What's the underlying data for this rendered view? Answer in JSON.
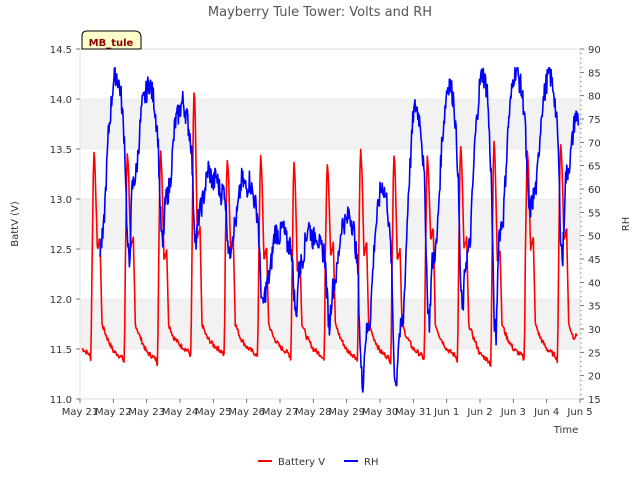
{
  "chart_data": {
    "type": "line",
    "title": "Mayberry Tule Tower: Volts and RH",
    "station_label": "MB_tule",
    "xlabel": "Time",
    "ylabel_left": "BattV (V)",
    "ylabel_right": "RH",
    "xlim": [
      "2016-05-21",
      "2016-06-05"
    ],
    "ylim_left": [
      11.0,
      14.5
    ],
    "ylim_right": [
      15,
      90
    ],
    "x_ticks": [
      "May 21",
      "May 22",
      "May 23",
      "May 24",
      "May 25",
      "May 26",
      "May 27",
      "May 28",
      "May 29",
      "May 30",
      "May 31",
      "Jun 1",
      "Jun 2",
      "Jun 3",
      "Jun 4",
      "Jun 5"
    ],
    "y_ticks_left": [
      "11.0",
      "11.5",
      "12.0",
      "12.5",
      "13.0",
      "13.5",
      "14.0",
      "14.5"
    ],
    "y_ticks_right": [
      "15",
      "20",
      "25",
      "30",
      "35",
      "40",
      "45",
      "50",
      "55",
      "60",
      "65",
      "70",
      "75",
      "80",
      "85",
      "90"
    ],
    "grid": "horizontal bands",
    "legend_position": "bottom-center",
    "series": [
      {
        "name": "Battery V",
        "axis": "left",
        "color": "#ff0000",
        "daily": [
          {
            "min": 11.4,
            "rise": 12.3,
            "peak": 13.5,
            "mid": 12.5
          },
          {
            "min": 11.36,
            "rise": 12.3,
            "peak": 13.5,
            "mid": 12.5
          },
          {
            "min": 11.35,
            "rise": 12.4,
            "peak": 13.5,
            "mid": 12.4
          },
          {
            "min": 11.42,
            "rise": 12.45,
            "peak": 14.1,
            "mid": 12.6
          },
          {
            "min": 11.42,
            "rise": 12.5,
            "peak": 13.43,
            "mid": 12.5
          },
          {
            "min": 11.4,
            "rise": 12.3,
            "peak": 13.45,
            "mid": 12.4
          },
          {
            "min": 11.4,
            "rise": 12.2,
            "peak": 13.4,
            "mid": 12.3
          },
          {
            "min": 11.38,
            "rise": 12.4,
            "peak": 13.4,
            "mid": 12.45
          },
          {
            "min": 11.37,
            "rise": 12.4,
            "peak": 13.52,
            "mid": 12.45
          },
          {
            "min": 11.36,
            "rise": 12.3,
            "peak": 13.48,
            "mid": 12.4
          },
          {
            "min": 11.38,
            "rise": 12.3,
            "peak": 13.45,
            "mid": 12.6
          },
          {
            "min": 11.38,
            "rise": 12.4,
            "peak": 13.55,
            "mid": 12.5
          },
          {
            "min": 11.33,
            "rise": 12.35,
            "peak": 13.6,
            "mid": 12.4
          },
          {
            "min": 11.38,
            "rise": 12.4,
            "peak": 13.5,
            "mid": 12.5
          },
          {
            "min": 11.38,
            "rise": 12.45,
            "peak": 13.6,
            "mid": 12.6
          },
          {
            "min": 11.52,
            "rise": 12.5,
            "peak": 13.57,
            "mid": 12.4
          }
        ]
      },
      {
        "name": "RH",
        "axis": "right",
        "color": "#0000ff",
        "daily": [
          {
            "max": 84,
            "min": 40,
            "rebound": 46
          },
          {
            "max": 85,
            "min": 43,
            "rebound": 60
          },
          {
            "max": 83,
            "min": 47,
            "rebound": 57
          },
          {
            "max": 79,
            "min": 48,
            "rebound": 54
          },
          {
            "max": 63,
            "min": 45,
            "rebound": 50
          },
          {
            "max": 62,
            "min": 34,
            "rebound": 38
          },
          {
            "max": 52,
            "min": 32,
            "rebound": 42
          },
          {
            "max": 51,
            "min": 30,
            "rebound": 38
          },
          {
            "max": 55,
            "min": 17,
            "rebound": 28
          },
          {
            "max": 61,
            "min": 17,
            "rebound": 28
          },
          {
            "max": 78,
            "min": 31,
            "rebound": 44
          },
          {
            "max": 83,
            "min": 33,
            "rebound": 44
          },
          {
            "max": 85,
            "min": 27,
            "rebound": 50
          },
          {
            "max": 86,
            "min": 55,
            "rebound": 57
          },
          {
            "max": 85,
            "min": 44,
            "rebound": 62
          },
          {
            "max": 77,
            "min": 61,
            "rebound": 65
          }
        ]
      }
    ]
  }
}
